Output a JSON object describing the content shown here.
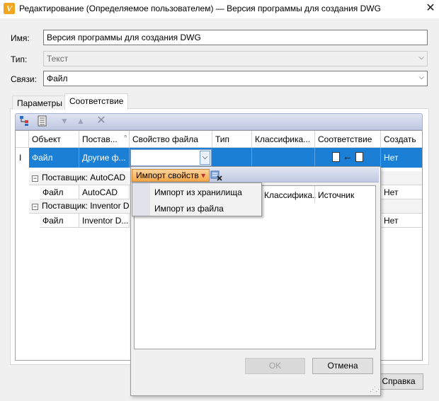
{
  "window": {
    "app_icon": "V",
    "title": "Редактирование (Определяемое пользователем) — Версия программы для создания DWG",
    "close_icon": "✕"
  },
  "form": {
    "name_label": "Имя:",
    "name_value": "Версия программы для создания DWG",
    "type_label": "Тип:",
    "type_value": "Текст",
    "links_label": "Связи:",
    "links_value": "Файл"
  },
  "tabs": [
    {
      "label": "Параметры",
      "active": false
    },
    {
      "label": "Соответствие",
      "active": true
    }
  ],
  "grid": {
    "columns": [
      "Объект",
      "Постав...",
      "Свойство файла",
      "Тип",
      "Классифика...",
      "Соответствие",
      "Создать"
    ],
    "selected_row": {
      "indicator": "I",
      "object": "Файл",
      "provider": "Другие ф...",
      "property": "",
      "type": "",
      "classification": "",
      "create": "Нет"
    },
    "groups": [
      {
        "header": "Поставщик: AutoCAD",
        "row": {
          "object": "Файл",
          "provider": "AutoCAD",
          "create": "Нет"
        }
      },
      {
        "header": "Поставщик: Inventor D",
        "row": {
          "object": "Файл",
          "provider": "Inventor D...",
          "create": "Нет"
        }
      }
    ]
  },
  "popup": {
    "import_button": "Импорт свойств",
    "dropdown_arrow": "▾",
    "menu_items": [
      "Импорт из хранилища",
      "Импорт из файла"
    ],
    "columns_partial": [
      "Классифика...",
      "Источник"
    ],
    "ok_button": "OK",
    "cancel_button": "Отмена",
    "grip": "⋰⋰"
  },
  "dialog_buttons": {
    "help": "Справка"
  },
  "colors": {
    "selection": "#1b7fd6",
    "accent_orange": "#f4a84a",
    "toolbar_blue": "#c9d1e8"
  }
}
